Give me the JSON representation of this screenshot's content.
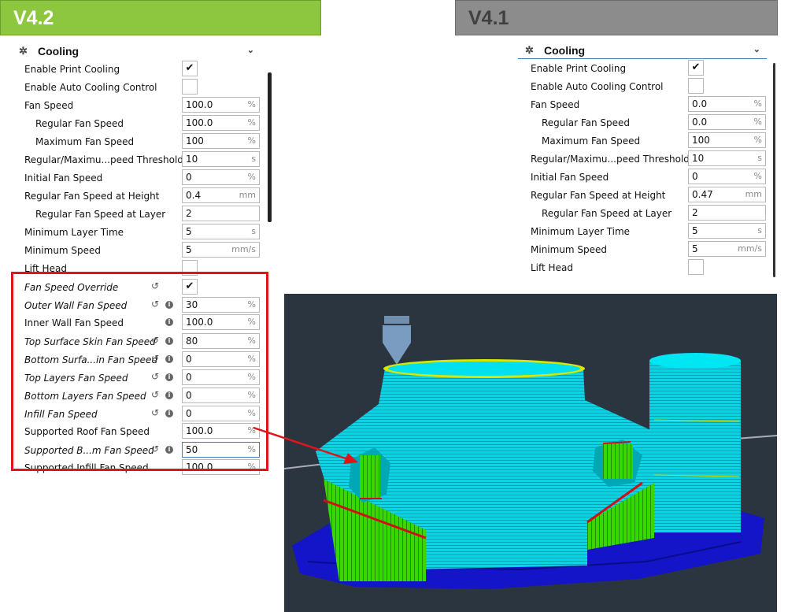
{
  "banners": {
    "left": "V4.2",
    "right": "V4.1"
  },
  "colors": {
    "banner_v42": "#8dc63f",
    "banner_v41": "#8c8c8c",
    "highlight": "#e0151b",
    "support_green": "#39d700",
    "model_cyan": "#00d8e6",
    "bed_blue": "#1010c0"
  },
  "v42": {
    "category": "Cooling",
    "icon": "fan-icon",
    "rows": [
      {
        "label": "Enable Print Cooling",
        "type": "check",
        "checked": true,
        "check": "✔"
      },
      {
        "label": "Enable Auto Cooling Control",
        "type": "check",
        "checked": false,
        "check": ""
      },
      {
        "label": "Fan Speed",
        "value": "100.0",
        "unit": "%"
      },
      {
        "label": "Regular Fan Speed",
        "value": "100.0",
        "unit": "%",
        "indent": true
      },
      {
        "label": "Maximum Fan Speed",
        "value": "100",
        "unit": "%",
        "indent": true
      },
      {
        "label": "Regular/Maximu...peed Threshold",
        "value": "10",
        "unit": "s"
      },
      {
        "label": "Initial Fan Speed",
        "value": "0",
        "unit": "%"
      },
      {
        "label": "Regular Fan Speed at Height",
        "value": "0.4",
        "unit": "mm"
      },
      {
        "label": "Regular Fan Speed at Layer",
        "value": "2",
        "unit": "",
        "indent": true
      },
      {
        "label": "Minimum Layer Time",
        "value": "5",
        "unit": "s"
      },
      {
        "label": "Minimum Speed",
        "value": "5",
        "unit": "mm/s"
      },
      {
        "label": "Lift Head",
        "type": "check",
        "checked": false,
        "check": ""
      },
      {
        "label": "Fan Speed Override",
        "type": "check",
        "checked": true,
        "check": "✔",
        "italic": true,
        "reset": true
      },
      {
        "label": "Outer Wall Fan Speed",
        "value": "30",
        "unit": "%",
        "italic": true,
        "reset": true,
        "info": true
      },
      {
        "label": "Inner Wall Fan Speed",
        "value": "100.0",
        "unit": "%",
        "info": true
      },
      {
        "label": "Top Surface Skin Fan Speed",
        "value": "80",
        "unit": "%",
        "italic": true,
        "reset": true,
        "info": true
      },
      {
        "label": "Bottom Surfa...in Fan Speed",
        "value": "0",
        "unit": "%",
        "italic": true,
        "reset": true,
        "info": true
      },
      {
        "label": "Top Layers Fan Speed",
        "value": "0",
        "unit": "%",
        "italic": true,
        "reset": true,
        "info": true
      },
      {
        "label": "Bottom Layers Fan Speed",
        "value": "0",
        "unit": "%",
        "italic": true,
        "reset": true,
        "info": true
      },
      {
        "label": "Infill Fan Speed",
        "value": "0",
        "unit": "%",
        "italic": true,
        "reset": true,
        "info": true
      },
      {
        "label": "Supported Roof Fan Speed",
        "value": "100.0",
        "unit": "%"
      },
      {
        "label": "Supported B...m Fan Speed",
        "value": "50",
        "unit": "%",
        "italic": true,
        "reset": true,
        "info": true,
        "active": true
      },
      {
        "label": "Supported Infill Fan Speed",
        "value": "100.0",
        "unit": "%"
      }
    ]
  },
  "v41": {
    "category": "Cooling",
    "icon": "fan-icon",
    "rows": [
      {
        "label": "Enable Print Cooling",
        "type": "check",
        "checked": true,
        "check": "✔"
      },
      {
        "label": "Enable Auto Cooling Control",
        "type": "check",
        "checked": false,
        "check": ""
      },
      {
        "label": "Fan Speed",
        "value": "0.0",
        "unit": "%"
      },
      {
        "label": "Regular Fan Speed",
        "value": "0.0",
        "unit": "%",
        "indent": true
      },
      {
        "label": "Maximum Fan Speed",
        "value": "100",
        "unit": "%",
        "indent": true
      },
      {
        "label": "Regular/Maximu...peed Threshold",
        "value": "10",
        "unit": "s"
      },
      {
        "label": "Initial Fan Speed",
        "value": "0",
        "unit": "%"
      },
      {
        "label": "Regular Fan Speed at Height",
        "value": "0.47",
        "unit": "mm"
      },
      {
        "label": "Regular Fan Speed at Layer",
        "value": "2",
        "unit": "",
        "indent": true
      },
      {
        "label": "Minimum Layer Time",
        "value": "5",
        "unit": "s"
      },
      {
        "label": "Minimum Speed",
        "value": "5",
        "unit": "mm/s"
      },
      {
        "label": "Lift Head",
        "type": "check",
        "checked": false,
        "check": ""
      }
    ]
  }
}
